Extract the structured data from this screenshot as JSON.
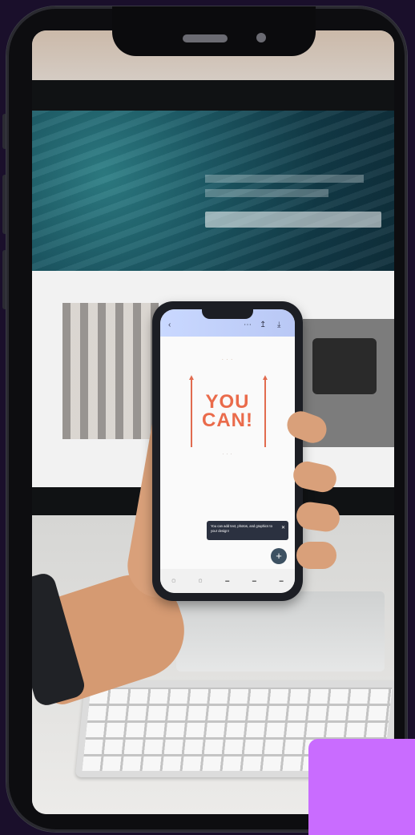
{
  "colors": {
    "background": "#1a0f2b",
    "accent_purple": "#c96cff",
    "poster_orange": "#ea6b4b"
  },
  "poster": {
    "headline_line1": "YOU",
    "headline_line2": "CAN!"
  },
  "tooltip": {
    "text": "You can add text, photos, and graphics to your design!",
    "close_icon": "close-icon"
  },
  "fab": {
    "icon": "plus-icon",
    "label": "+"
  }
}
